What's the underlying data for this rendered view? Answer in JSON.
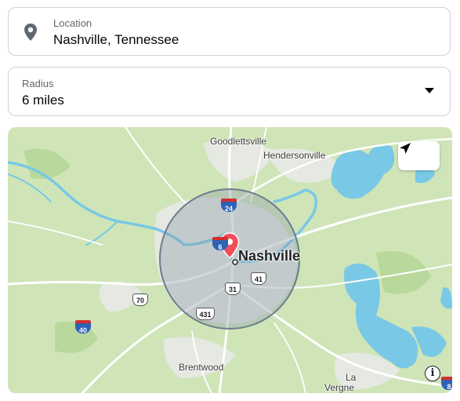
{
  "location": {
    "label": "Location",
    "value": "Nashville, Tennessee",
    "icon": "location-pin-icon"
  },
  "radius": {
    "label": "Radius",
    "value": "6 miles",
    "icon": "caret-down-icon"
  },
  "map": {
    "controls": {
      "locate_icon": "navigation-arrow-icon",
      "info_icon": "info-icon",
      "info_label": "i"
    },
    "center_label": "Nashville",
    "places": {
      "goodlettsville": "Goodlettsville",
      "hendersonville": "Hendersonville",
      "brentwood": "Brentwood",
      "la": "La",
      "vergne": "Vergne"
    },
    "routes": {
      "i24": "24",
      "i40": "40",
      "i65_partial": "6",
      "i8_partial": "8",
      "us31": "31",
      "us41": "41",
      "us70": "70",
      "us431": "431"
    },
    "colors": {
      "land": "#cfe5b8",
      "water": "#79c8e6",
      "urban": "#e3e6e1",
      "radius_fill": "#8a98a8",
      "radius_stroke": "#6b7c8c",
      "pin": "#ef4f5a"
    }
  }
}
